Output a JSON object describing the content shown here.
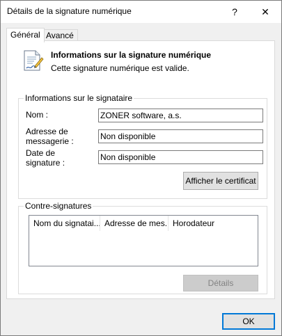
{
  "window": {
    "title": "Détails de la signature numérique",
    "help_glyph": "?",
    "close_glyph": "✕"
  },
  "tabs": [
    {
      "label": "Général",
      "active": true
    },
    {
      "label": "Avancé",
      "active": false
    }
  ],
  "info": {
    "title": "Informations sur la signature numérique",
    "status": "Cette signature numérique est valide.",
    "icon": "signed-document-icon"
  },
  "signer": {
    "group_label": "Informations sur le signataire",
    "name_label": "Nom :",
    "name_value": "ZONER software, a.s.",
    "email_label_line1": "Adresse de",
    "email_label_line2": "messagerie :",
    "email_value": "Non disponible",
    "date_label_line1": "Date de",
    "date_label_line2": "signature :",
    "date_value": "Non disponible",
    "view_cert_label": "Afficher le certificat"
  },
  "countersignatures": {
    "group_label": "Contre-signatures",
    "columns": [
      "Nom du signatai...",
      "Adresse de mes...",
      "Horodateur"
    ],
    "details_label": "Détails"
  },
  "footer": {
    "ok_label": "OK"
  },
  "colors": {
    "accent": "#0078d7",
    "panel_bg": "#ffffff",
    "window_bg": "#f0f0f0"
  }
}
